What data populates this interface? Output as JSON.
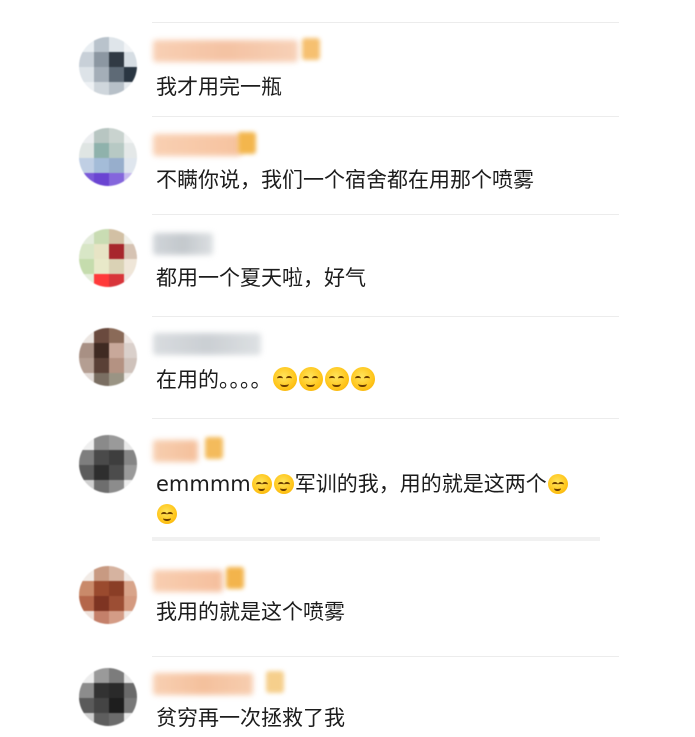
{
  "comments": [
    {
      "text": "我才用完一瓶"
    },
    {
      "text": "不瞒你说，我们一个宿舍都在用那个喷雾"
    },
    {
      "text": "都用一个夏天啦，好气"
    },
    {
      "text": "在用的。。。。",
      "emoji": "smile-emoji"
    },
    {
      "text_line1_prefix": "emmmm",
      "text_line1_middle": "军训的我，用的就是这两个",
      "emoji": "smile-emoji"
    },
    {
      "text": "我用的就是这个喷雾"
    },
    {
      "text": "贫穷再一次拯救了我"
    }
  ]
}
